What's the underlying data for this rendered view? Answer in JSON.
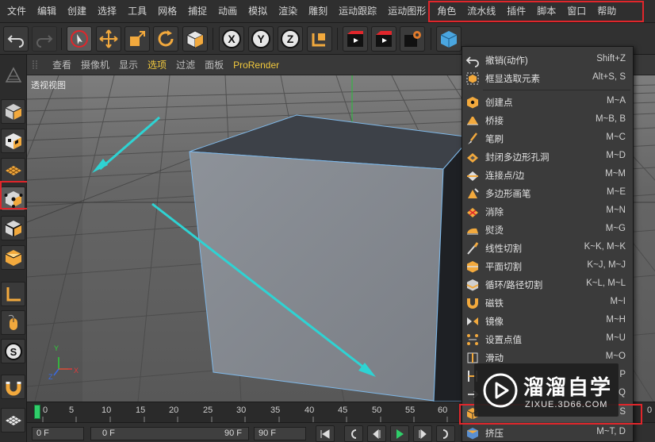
{
  "menubar": {
    "items": [
      "文件",
      "编辑",
      "创建",
      "选择",
      "工具",
      "网格",
      "捕捉",
      "动画",
      "模拟",
      "渲染",
      "雕刻",
      "运动跟踪",
      "运动图形",
      "角色",
      "流水线",
      "插件",
      "脚本",
      "窗口",
      "帮助"
    ]
  },
  "viewport": {
    "menu": [
      "查看",
      "摄像机",
      "显示",
      "选项",
      "过滤",
      "面板",
      "ProRender"
    ],
    "label": "透视视图",
    "axis_y": "Y",
    "axis_x": "X",
    "axis_z": "Z"
  },
  "timeline": {
    "ticks": [
      "0",
      "5",
      "10",
      "15",
      "20",
      "25",
      "30",
      "35",
      "40",
      "45",
      "50",
      "55",
      "60",
      "0"
    ],
    "current_frame_field": "0 F",
    "start_field": "0 F",
    "end_field_inner": "90 F",
    "end_field": "90 F"
  },
  "context_menu": {
    "items": [
      {
        "label": "撤销(动作)",
        "shortcut": "Shift+Z",
        "icon": "undo-action-icon"
      },
      {
        "label": "框显选取元素",
        "shortcut": "Alt+S, S",
        "icon": "frame-selection-icon"
      },
      {
        "label": "创建点",
        "shortcut": "M~A",
        "icon": "create-point-icon"
      },
      {
        "label": "桥接",
        "shortcut": "M~B, B",
        "icon": "bridge-icon"
      },
      {
        "label": "笔刷",
        "shortcut": "M~C",
        "icon": "brush-icon"
      },
      {
        "label": "封闭多边形孔洞",
        "shortcut": "M~D",
        "icon": "close-polygon-hole-icon"
      },
      {
        "label": "连接点/边",
        "shortcut": "M~M",
        "icon": "connect-points-edges-icon"
      },
      {
        "label": "多边形画笔",
        "shortcut": "M~E",
        "icon": "polygon-pen-icon"
      },
      {
        "label": "消除",
        "shortcut": "M~N",
        "icon": "dissolve-icon"
      },
      {
        "label": "熨烫",
        "shortcut": "M~G",
        "icon": "iron-icon"
      },
      {
        "label": "线性切割",
        "shortcut": "K~K, M~K",
        "icon": "line-cut-icon"
      },
      {
        "label": "平面切割",
        "shortcut": "K~J, M~J",
        "icon": "plane-cut-icon"
      },
      {
        "label": "循环/路径切割",
        "shortcut": "K~L, M~L",
        "icon": "loop-path-cut-icon"
      },
      {
        "label": "磁铁",
        "shortcut": "M~I",
        "icon": "magnet-icon"
      },
      {
        "label": "镜像",
        "shortcut": "M~H",
        "icon": "mirror-icon"
      },
      {
        "label": "设置点值",
        "shortcut": "M~U",
        "icon": "set-point-value-icon"
      },
      {
        "label": "滑动",
        "shortcut": "M~O",
        "icon": "slide-icon"
      },
      {
        "label": "",
        "shortcut": "P",
        "icon": "stitch-icon"
      },
      {
        "label": "",
        "shortcut": "Q",
        "icon": "weld-icon"
      },
      {
        "label": "",
        "shortcut": "S",
        "icon": "bevel-icon"
      },
      {
        "label": "挤压",
        "shortcut": "M~T, D",
        "icon": "extrude-icon"
      }
    ]
  },
  "watermark": {
    "title": "溜溜自学",
    "url": "ZIXUE.3D66.COM"
  },
  "colors": {
    "accent_yellow": "#f2c93d",
    "highlight_red": "#e0262b",
    "arrow_cyan": "#2ed3d3",
    "playhead_green": "#2fcf6a"
  }
}
